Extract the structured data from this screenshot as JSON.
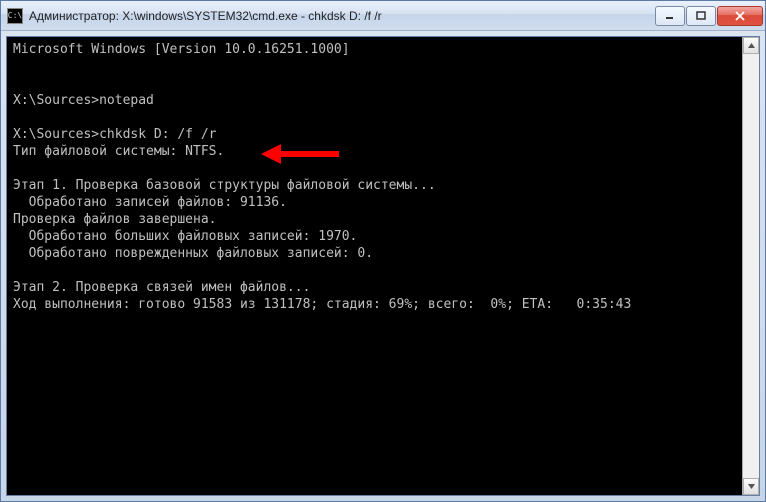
{
  "window": {
    "title": "Администратор: X:\\windows\\SYSTEM32\\cmd.exe - chkdsk  D: /f /r",
    "app_icon_glyph": "C:\\"
  },
  "arrow": {
    "color": "#ff0000"
  },
  "console": {
    "lines": [
      "Microsoft Windows [Version 10.0.16251.1000]",
      "",
      "",
      "X:\\Sources>notepad",
      "",
      "X:\\Sources>chkdsk D: /f /r",
      "Тип файловой системы: NTFS.",
      "",
      "Этап 1. Проверка базовой структуры файловой системы...",
      "  Обработано записей файлов: 91136.",
      "Проверка файлов завершена.",
      "  Обработано больших файловых записей: 1970.",
      "  Обработано поврежденных файловых записей: 0.",
      "",
      "Этап 2. Проверка связей имен файлов...",
      "Ход выполнения: готово 91583 из 131178; стадия: 69%; всего:  0%; ETA:   0:35:43"
    ]
  }
}
